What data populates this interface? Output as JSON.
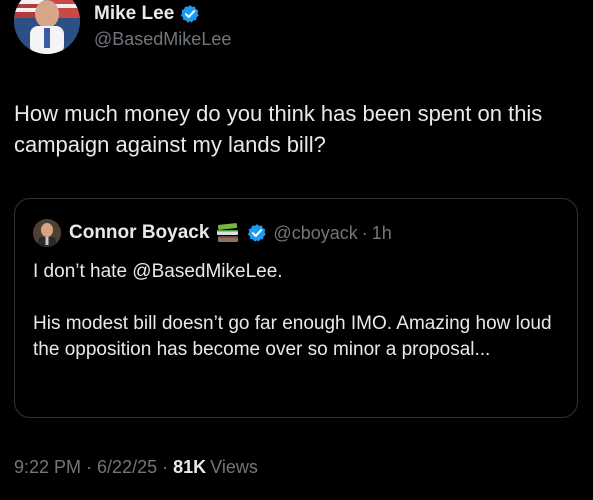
{
  "author": {
    "display_name": "Mike Lee",
    "handle": "@BasedMikeLee",
    "verified_icon": "verified-badge-icon"
  },
  "tweet": {
    "text": "How much money do you think has been spent on this campaign against my lands bill?"
  },
  "quoted_tweet": {
    "display_name": "Connor Boyack",
    "emoji_icon": "books-icon",
    "verified_icon": "verified-badge-icon",
    "handle": "@cboyack",
    "separator": "·",
    "time": "1h",
    "body_line_1": "I don’t hate @BasedMikeLee.",
    "body_line_2": "His modest bill doesn’t go far enough IMO. Amazing how loud the opposition has become over so minor a proposal..."
  },
  "meta": {
    "time": "9:22 PM",
    "separator": "·",
    "date": "6/22/25",
    "views_count": "81K",
    "views_label": "Views"
  },
  "colors": {
    "background": "#000000",
    "primary_text": "#e7e9ea",
    "secondary_text": "#71767b",
    "border": "#2f3336",
    "verified_blue": "#1d9bf0"
  }
}
